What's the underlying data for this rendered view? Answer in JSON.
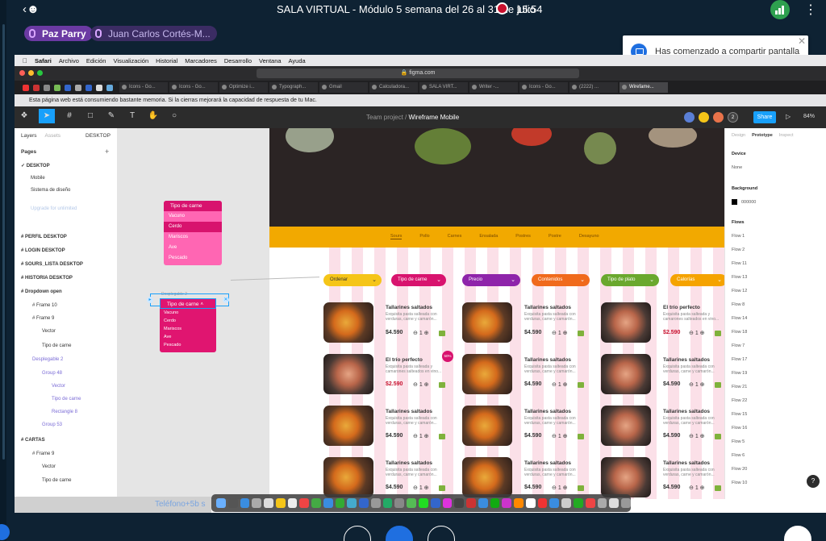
{
  "call": {
    "title": "SALA VIRTUAL - Módulo 5 semana del 26 al 31 de julio",
    "time": "15:54",
    "participants": [
      "Paz Parry",
      "Juan Carlos Cortés-M..."
    ]
  },
  "toast": {
    "text": "Has comenzado a compartir pantalla"
  },
  "mac_menu": [
    "Safari",
    "Archivo",
    "Edición",
    "Visualización",
    "Historial",
    "Marcadores",
    "Desarrollo",
    "Ventana",
    "Ayuda"
  ],
  "browser": {
    "url": "figma.com",
    "tabs": [
      "Icons - Go...",
      "Icons - Go...",
      "Optimize i...",
      "Typograph...",
      "Gmail",
      "Calculadora...",
      "SALA VIRT...",
      "Writer -...",
      "Icons - Go...",
      "(2222) ...",
      "Wirefame..."
    ],
    "memory_warning": "Esta página web está consumiendo bastante memoria. Si la cierras mejorará la capacidad de respuesta de tu Mac."
  },
  "figma": {
    "project": "Team project",
    "file": "Wireframe Mobile",
    "share": "Share",
    "zoom": "84%",
    "collaborators_extra": "2",
    "left_tabs": [
      "Layers",
      "Assets",
      "DESKTOP"
    ],
    "pages_heading": "Pages",
    "pages": [
      "DESKTOP",
      "Mobile",
      "Sistema de diseño",
      "Upgrade for unlimited"
    ],
    "layers": [
      "PERFIL DESKTOP",
      "LOGIN DESKTOP",
      "SOURS_LISTA DESKTOP",
      "HISTORIA DESKTOP",
      "Dropdown open",
      "Frame 10",
      "Frame 9",
      "Vector",
      "Tipo de carne",
      "Desplegable 2",
      "Group 48",
      "Vector",
      "Tipo de carne",
      "Rectangle 8",
      "Group 53",
      "CARTAS",
      "Frame 9",
      "Vector",
      "Tipo de carne"
    ],
    "right_tabs": [
      "Design",
      "Prototype",
      "Inspect"
    ],
    "device_label": "Device",
    "device_value": "None",
    "background_label": "Background",
    "background_value": "000000",
    "flows_label": "Flows",
    "flows": [
      "Flow 1",
      "Flow 2",
      "Flow 11",
      "Flow 13",
      "Flow 12",
      "Flow 8",
      "Flow 14",
      "Flow 18",
      "Flow 7",
      "Flow 17",
      "Flow 19",
      "Flow 21",
      "Flow 22",
      "Flow 15",
      "Flow 16",
      "Flow 5",
      "Flow 6",
      "Flow 20",
      "Flow 10"
    ]
  },
  "dropdown_top": {
    "title": "Tipo de carne",
    "options": [
      "Vacuno",
      "Cerdo",
      "Mariscos",
      "Ave",
      "Pescado"
    ]
  },
  "dropdown_selected": {
    "label": "Desplegable 2",
    "title": "Tipo de carne",
    "options": [
      "Vacuno",
      "Cerdo",
      "Mariscos",
      "Ave",
      "Pescado"
    ]
  },
  "site": {
    "nav": [
      "Sours",
      "Pollo",
      "Carnes",
      "Ensalada",
      "Postres",
      "Postre",
      "Desayuno"
    ],
    "filters": [
      "Ordenar",
      "Tipo de carne",
      "Precio",
      "Contenidos",
      "Tipo de plato",
      "Calorías"
    ],
    "badge": "50%",
    "cards": [
      {
        "title": "Tallarines saltados",
        "desc": "Exquisita pasta salteada con verduras, carne y camarón...",
        "price": "$4.590",
        "qty": "1"
      },
      {
        "title": "Tallarines saltados",
        "desc": "Exquisita pasta salteada con verduras, carne y camarón...",
        "price": "$4.590",
        "qty": "1"
      },
      {
        "title": "El trío perfecto",
        "desc": "Exquisita pasta salteada y camarones salteados en vino...",
        "price": "$2.590",
        "qty": "1"
      },
      {
        "title": "El trío perfecto",
        "desc": "Exquisita pasta salteada y camarones salteados en vino...",
        "price": "$2.590",
        "qty": "1"
      },
      {
        "title": "Tallarines saltados",
        "desc": "Exquisita pasta salteada con verduras, carne y camarón...",
        "price": "$4.590",
        "qty": "1"
      },
      {
        "title": "Tallarines saltados",
        "desc": "Exquisita pasta salteada con verduras, carne y camarón...",
        "price": "$4.590",
        "qty": "1"
      },
      {
        "title": "Tallarines saltados",
        "desc": "Exquisita pasta salteada con verduras, carne y camarón...",
        "price": "$4.590",
        "qty": "1"
      },
      {
        "title": "Tallarines saltados",
        "desc": "Exquisita pasta salteada con verduras, carne y camarón...",
        "price": "$4.590",
        "qty": "1"
      },
      {
        "title": "Tallarines saltados",
        "desc": "Exquisita pasta salteada con verduras, carne y camarón...",
        "price": "$4.590",
        "qty": "1"
      },
      {
        "title": "Tallarines saltados",
        "desc": "Exquisita pasta salteada con verduras, carne y camarón...",
        "price": "$4.590",
        "qty": "1"
      },
      {
        "title": "Tallarines saltados",
        "desc": "Exquisita pasta salteada con verduras, carne y camarón...",
        "price": "$4.590",
        "qty": "1"
      },
      {
        "title": "Tallarines saltados",
        "desc": "Exquisita pasta salteada con verduras, carne y camarón...",
        "price": "$4.590",
        "qty": "1"
      }
    ]
  },
  "dock_label": "Teléfono+5b s",
  "colors": {
    "accent": "#18a0fb",
    "pink": "#e01570",
    "orange": "#f2a900",
    "call_blue": "#1f6fe0"
  }
}
